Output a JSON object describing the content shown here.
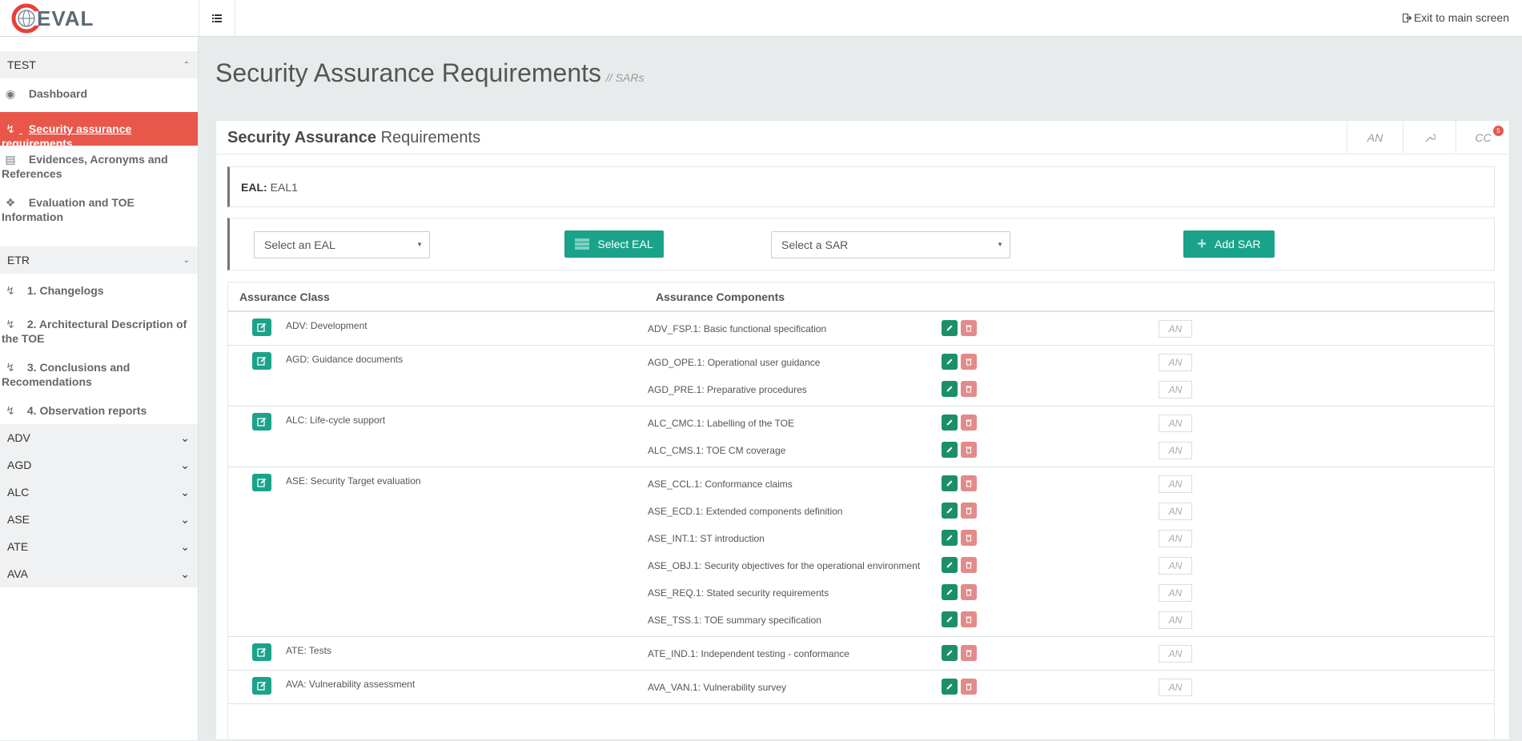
{
  "header": {
    "logo_text": "EVAL",
    "exit_label": "Exit to main screen"
  },
  "sidebar": {
    "test_group": "TEST",
    "items": [
      {
        "label": "Dashboard",
        "icon": "dashboard-icon"
      },
      {
        "label": "Security assurance requirements",
        "icon": "bolt-icon"
      },
      {
        "label": "Evidences, Acronyms and References",
        "icon": "book-icon"
      },
      {
        "label": "Evaluation and TOE Information",
        "icon": "info-icon"
      }
    ],
    "etr_group": "ETR",
    "etr_items": [
      {
        "label": "1. Changelogs"
      },
      {
        "label": "2. Architectural Description of the TOE"
      },
      {
        "label": "3. Conclusions and Recomendations"
      },
      {
        "label": "4. Observation reports"
      }
    ],
    "collapsed_groups": [
      "ADV",
      "AGD",
      "ALC",
      "ASE",
      "ATE",
      "AVA"
    ]
  },
  "page": {
    "title": "Security Assurance Requirements",
    "subtitle": "// SARs"
  },
  "card": {
    "title_bold": "Security Assurance",
    "title_rest": " Requirements",
    "tab_an": "AN",
    "tab_cc": "CC",
    "cc_badge": "5"
  },
  "eal": {
    "label": "EAL:",
    "value": "EAL1"
  },
  "controls": {
    "eal_placeholder": "Select an EAL",
    "select_eal_button": "Select EAL",
    "sar_placeholder": "Select a SAR",
    "add_sar_button": "Add SAR"
  },
  "table": {
    "col_class": "Assurance Class",
    "col_components": "Assurance Components",
    "an_label": "AN",
    "groups": [
      {
        "cls": "ADV: Development",
        "components": [
          "ADV_FSP.1: Basic functional specification"
        ]
      },
      {
        "cls": "AGD: Guidance documents",
        "components": [
          "AGD_OPE.1: Operational user guidance",
          "AGD_PRE.1: Preparative procedures"
        ]
      },
      {
        "cls": "ALC: Life-cycle support",
        "components": [
          "ALC_CMC.1: Labelling of the TOE",
          "ALC_CMS.1: TOE CM coverage"
        ]
      },
      {
        "cls": "ASE: Security Target evaluation",
        "components": [
          "ASE_CCL.1: Conformance claims",
          "ASE_ECD.1: Extended components definition",
          "ASE_INT.1: ST introduction",
          "ASE_OBJ.1: Security objectives for the operational environment",
          "ASE_REQ.1: Stated security requirements",
          "ASE_TSS.1: TOE summary specification"
        ]
      },
      {
        "cls": "ATE: Tests",
        "components": [
          "ATE_IND.1: Independent testing - conformance"
        ]
      },
      {
        "cls": "AVA: Vulnerability assessment",
        "components": [
          "AVA_VAN.1: Vulnerability survey"
        ]
      }
    ]
  }
}
